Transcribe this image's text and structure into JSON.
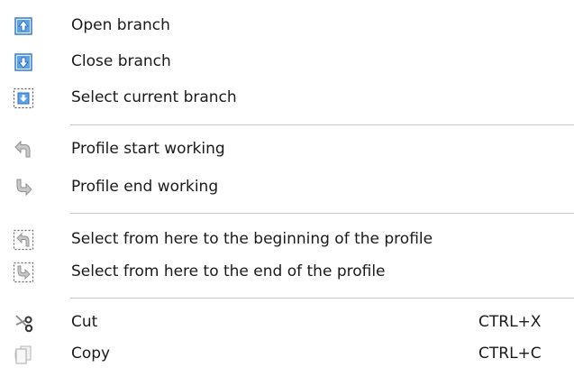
{
  "menu": {
    "items": [
      {
        "label": "Open branch",
        "icon": "branch-open-arrow-up-icon",
        "shortcut": ""
      },
      {
        "label": "Close branch",
        "icon": "branch-close-arrow-down-icon",
        "shortcut": ""
      },
      {
        "label": "Select current branch",
        "icon": "select-branch-icon",
        "shortcut": ""
      },
      {
        "label": "Profile start working",
        "icon": "profile-start-arrow-icon",
        "shortcut": ""
      },
      {
        "label": "Profile end working",
        "icon": "profile-end-arrow-icon",
        "shortcut": ""
      },
      {
        "label": "Select from here to the beginning of the profile",
        "icon": "select-to-beginning-icon",
        "shortcut": ""
      },
      {
        "label": "Select from here to the end of the profile",
        "icon": "select-to-end-icon",
        "shortcut": ""
      },
      {
        "label": "Cut",
        "icon": "scissors-icon",
        "shortcut": "CTRL+X"
      },
      {
        "label": "Copy",
        "icon": "copy-pages-icon",
        "shortcut": "CTRL+C"
      }
    ]
  },
  "colors": {
    "text": "#1a1a1a",
    "separator": "#c9c9c9",
    "icon_blue": "#2f7fd6",
    "icon_gray": "#8f8f8f"
  }
}
